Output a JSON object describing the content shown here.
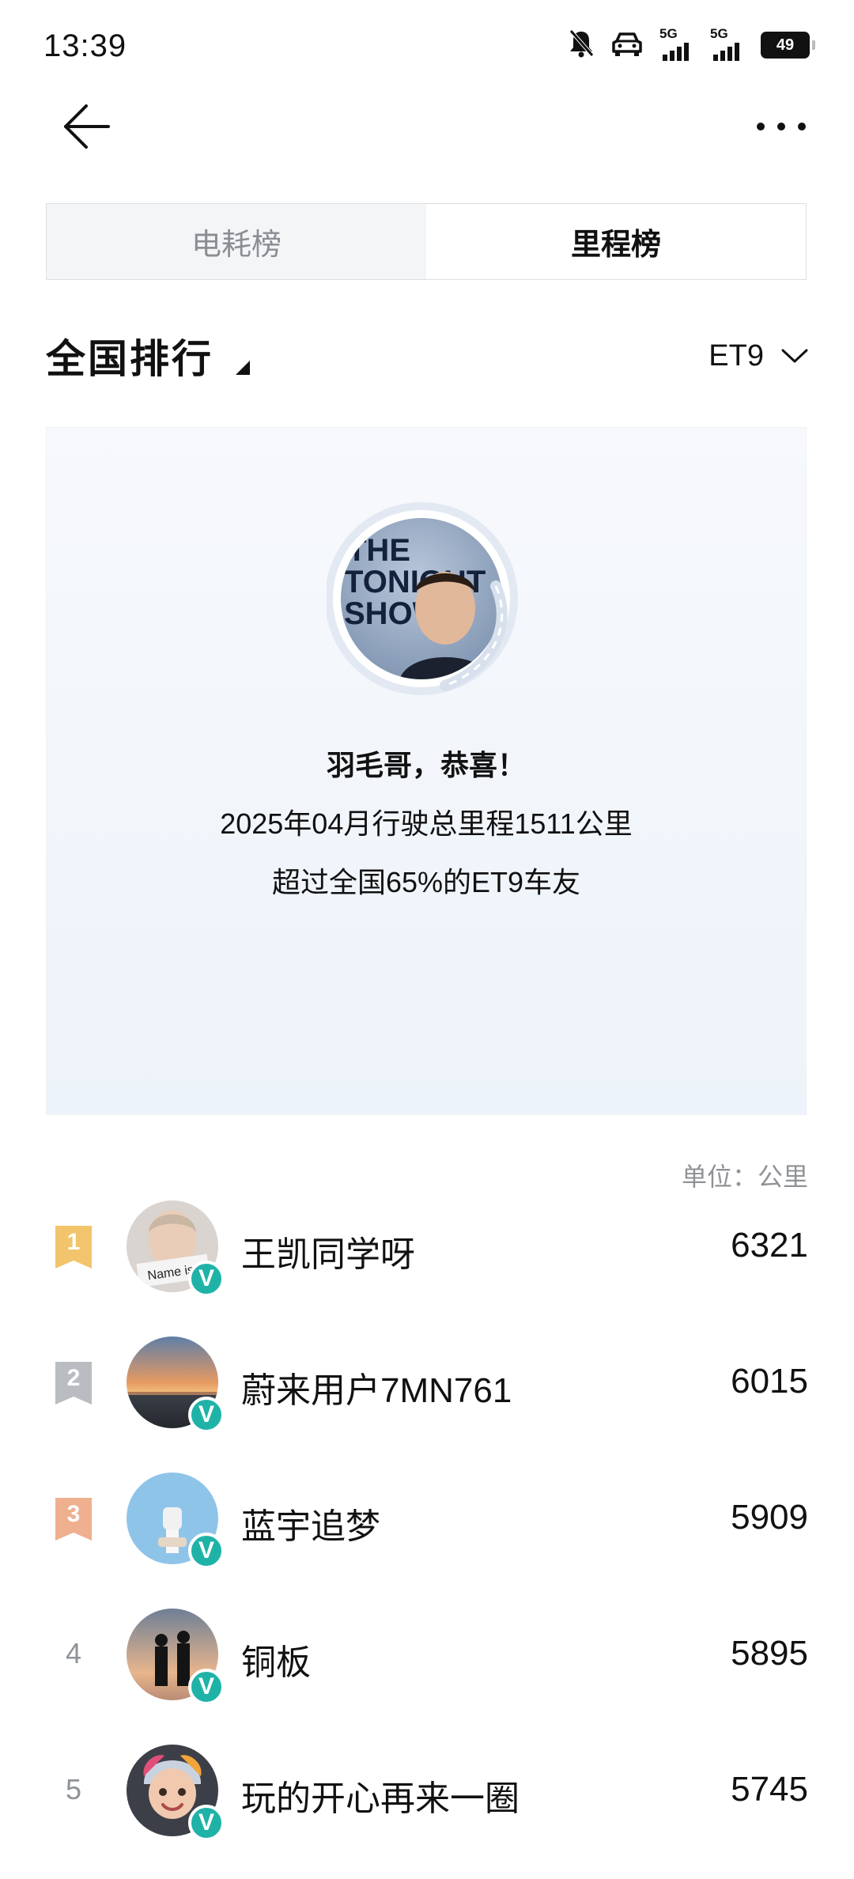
{
  "status_bar": {
    "time": "13:39",
    "net1": "5G",
    "net2": "5G",
    "battery": "49"
  },
  "tabs": [
    {
      "label": "电耗榜",
      "active": false
    },
    {
      "label": "里程榜",
      "active": true
    }
  ],
  "ranking": {
    "scope_label": "全国排行",
    "model": "ET9",
    "unit": "单位：公里"
  },
  "summary": {
    "congrats": "羽毛哥，恭喜！",
    "mileage_line": "2025年04月行驶总里程1511公里",
    "percentile_line": "超过全国65%的ET9车友"
  },
  "leaderboard": [
    {
      "rank": "1",
      "name": "王凯同学呀",
      "value": "6321",
      "badge_color": "#f2c46b"
    },
    {
      "rank": "2",
      "name": "蔚来用户7MN761",
      "value": "6015",
      "badge_color": "#b9bcc1"
    },
    {
      "rank": "3",
      "name": "蓝宇追梦",
      "value": "5909",
      "badge_color": "#eeb08f"
    },
    {
      "rank": "4",
      "name": "铜板",
      "value": "5895"
    },
    {
      "rank": "5",
      "name": "玩的开心再来一圈",
      "value": "5745"
    }
  ],
  "verified_mark": "V"
}
